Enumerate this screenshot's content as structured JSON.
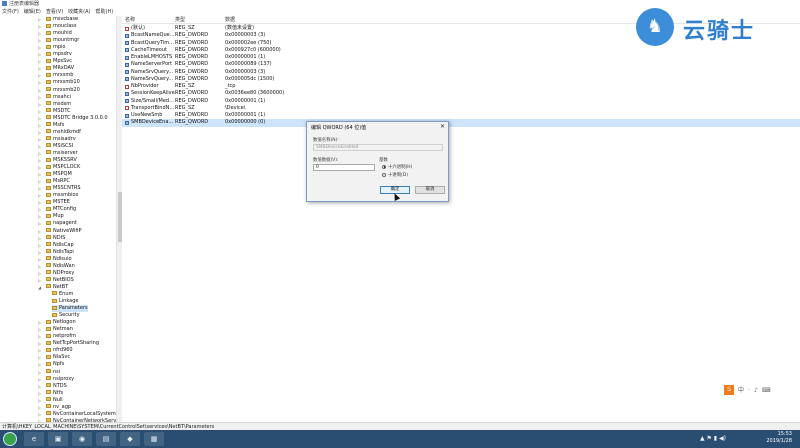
{
  "window": {
    "title": "注册表编辑器"
  },
  "menu": [
    "文件(F)",
    "编辑(E)",
    "查看(V)",
    "收藏夹(A)",
    "帮助(H)"
  ],
  "tree": {
    "items": [
      {
        "label": "msvcbase",
        "expandable": true
      },
      {
        "label": "mouclass",
        "expandable": true
      },
      {
        "label": "mouhid",
        "expandable": true
      },
      {
        "label": "mountmgr",
        "expandable": true
      },
      {
        "label": "mpio",
        "expandable": true
      },
      {
        "label": "mpsdrv",
        "expandable": true
      },
      {
        "label": "MpsSvc",
        "expandable": true
      },
      {
        "label": "MRxDAV",
        "expandable": true
      },
      {
        "label": "mrxsmb",
        "expandable": true
      },
      {
        "label": "mrxsmb10",
        "expandable": true
      },
      {
        "label": "mrxsmb20",
        "expandable": true
      },
      {
        "label": "msahci",
        "expandable": true
      },
      {
        "label": "msdsm",
        "expandable": true
      },
      {
        "label": "MSDTC",
        "expandable": true
      },
      {
        "label": "MSDTC Bridge 3.0.0.0",
        "expandable": true
      },
      {
        "label": "Msfs",
        "expandable": true
      },
      {
        "label": "mshidkmdf",
        "expandable": true
      },
      {
        "label": "msisadrv",
        "expandable": true
      },
      {
        "label": "MSiSCSI",
        "expandable": true
      },
      {
        "label": "msiserver",
        "expandable": true
      },
      {
        "label": "MSKSSRV",
        "expandable": true
      },
      {
        "label": "MSPCLOCK",
        "expandable": true
      },
      {
        "label": "MSPQM",
        "expandable": true
      },
      {
        "label": "MsRPC",
        "expandable": true
      },
      {
        "label": "MSSCNTRS",
        "expandable": true
      },
      {
        "label": "mssmbios",
        "expandable": true
      },
      {
        "label": "MSTEE",
        "expandable": true
      },
      {
        "label": "MTConfig",
        "expandable": true
      },
      {
        "label": "Mup",
        "expandable": true
      },
      {
        "label": "napagent",
        "expandable": true
      },
      {
        "label": "NativeWifiP",
        "expandable": true
      },
      {
        "label": "NDIS",
        "expandable": true
      },
      {
        "label": "NdisCap",
        "expandable": true
      },
      {
        "label": "NdisTapi",
        "expandable": true
      },
      {
        "label": "Ndisuio",
        "expandable": true
      },
      {
        "label": "NdisWan",
        "expandable": true
      },
      {
        "label": "NDProxy",
        "expandable": true
      },
      {
        "label": "NetBIOS",
        "expandable": true
      },
      {
        "label": "NetBT",
        "expandable": true,
        "expanded": true
      },
      {
        "label": "Enum",
        "child": true
      },
      {
        "label": "Linkage",
        "child": true
      },
      {
        "label": "Parameters",
        "child": true,
        "selected": true
      },
      {
        "label": "Security",
        "child": true
      },
      {
        "label": "Netlogon",
        "expandable": true
      },
      {
        "label": "Netman",
        "expandable": true
      },
      {
        "label": "netprofm",
        "expandable": true
      },
      {
        "label": "NetTcpPortSharing",
        "expandable": true
      },
      {
        "label": "nfrd960",
        "expandable": true
      },
      {
        "label": "NlaSvc",
        "expandable": true
      },
      {
        "label": "Npfs",
        "expandable": true
      },
      {
        "label": "nsi",
        "expandable": true
      },
      {
        "label": "nsiproxy",
        "expandable": true
      },
      {
        "label": "NTDS",
        "expandable": true
      },
      {
        "label": "Ntfs",
        "expandable": true
      },
      {
        "label": "Null",
        "expandable": true
      },
      {
        "label": "nv_agp",
        "expandable": true
      },
      {
        "label": "NvContainerLocalSystem",
        "expandable": true
      },
      {
        "label": "NvContainerNetworkServi",
        "expandable": true
      }
    ]
  },
  "list": {
    "headers": {
      "name": "名称",
      "type": "类型",
      "data": "数据"
    },
    "rows": [
      {
        "icon": "sz",
        "name": "(默认)",
        "type": "REG_SZ",
        "data": "(数值未设置)"
      },
      {
        "icon": "dw",
        "name": "BcastNameQue...",
        "type": "REG_DWORD",
        "data": "0x00000003 (3)"
      },
      {
        "icon": "dw",
        "name": "BcastQueryTim...",
        "type": "REG_DWORD",
        "data": "0x000002ee (750)"
      },
      {
        "icon": "dw",
        "name": "CacheTimeout",
        "type": "REG_DWORD",
        "data": "0x000927c0 (600000)"
      },
      {
        "icon": "dw",
        "name": "EnableLMHOSTS",
        "type": "REG_DWORD",
        "data": "0x00000001 (1)"
      },
      {
        "icon": "dw",
        "name": "NameServerPort",
        "type": "REG_DWORD",
        "data": "0x00000089 (137)"
      },
      {
        "icon": "dw",
        "name": "NameSrvQuery...",
        "type": "REG_DWORD",
        "data": "0x00000003 (3)"
      },
      {
        "icon": "dw",
        "name": "NameSrvQuery...",
        "type": "REG_DWORD",
        "data": "0x000005dc (1500)"
      },
      {
        "icon": "sz",
        "name": "NbProvider",
        "type": "REG_SZ",
        "data": "_tcp"
      },
      {
        "icon": "dw",
        "name": "SessionKeepAlive",
        "type": "REG_DWORD",
        "data": "0x0036ee80 (3600000)"
      },
      {
        "icon": "dw",
        "name": "Size/Small/Med...",
        "type": "REG_DWORD",
        "data": "0x00000001 (1)"
      },
      {
        "icon": "sz",
        "name": "TransportBindN...",
        "type": "REG_SZ",
        "data": "\\Device\\"
      },
      {
        "icon": "dw",
        "name": "UseNewSmb",
        "type": "REG_DWORD",
        "data": "0x00000001 (1)"
      },
      {
        "icon": "dw",
        "name": "SMBDeviceEna...",
        "type": "REG_QWORD",
        "data": "0x00000000 (0)",
        "selected": true
      }
    ]
  },
  "dialog": {
    "title": "编辑 QWORD (64 位)值",
    "close": "✕",
    "name_label": "数值名称(N):",
    "name_value": "SMBDeviceEnabled",
    "data_label": "数值数据(V):",
    "data_value": "0",
    "base_label": "基数",
    "radio_hex": "十六进制(H)",
    "radio_dec": "十进制(D)",
    "ok": "确定",
    "cancel": "取消"
  },
  "logo": {
    "glyph": "♞",
    "text": "云骑士"
  },
  "ime": {
    "s": "S",
    "items": [
      "中",
      "·",
      "♪",
      "⌨"
    ]
  },
  "status": {
    "path": "计算机\\HKEY_LOCAL_MACHINE\\SYSTEM\\CurrentControlSet\\services\\NetBT\\Parameters"
  },
  "taskbar": {
    "buttons": [
      "e",
      "▣",
      "◉",
      "▤",
      "◆",
      "▦"
    ],
    "tray": "▲ ⚑ ▮ ◀)",
    "time": "15:53",
    "date": "2019/1/28"
  }
}
